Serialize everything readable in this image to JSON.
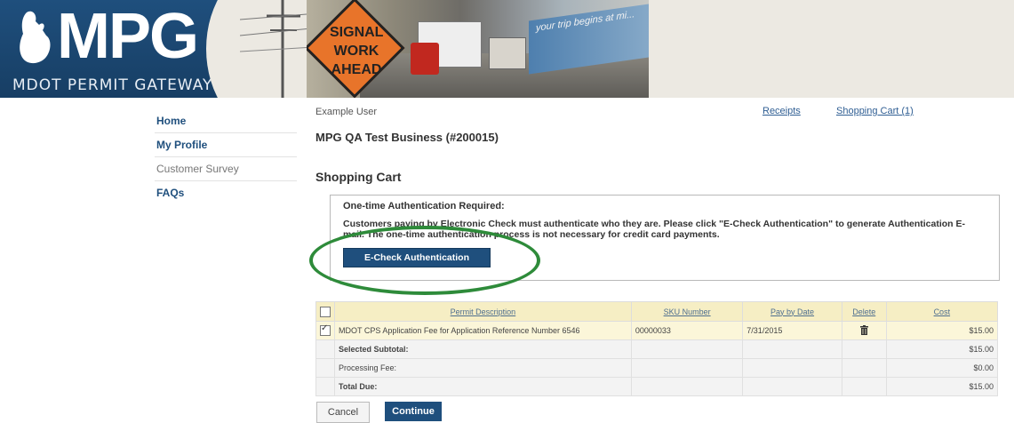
{
  "banner": {
    "logo_text": "MPG",
    "logo_subtitle": "MDOT PERMIT GATEWAY",
    "sign_text": "SIGNAL WORK AHEAD",
    "billboard_text": "your trip begins at mi..."
  },
  "nav": {
    "items": [
      {
        "label": "Home"
      },
      {
        "label": "My Profile"
      },
      {
        "label": "Customer Survey"
      },
      {
        "label": "FAQs"
      }
    ]
  },
  "header": {
    "user": "Example User",
    "receipts_link": "Receipts",
    "cart_link": "Shopping Cart (1)",
    "business": "MPG QA Test Business (#200015)",
    "page_title": "Shopping Cart"
  },
  "auth": {
    "title": "One-time Authentication Required:",
    "message": "Customers paying by Electronic Check must authenticate who they are. Please click \"E-Check Authentication\" to generate Authentication E-mail. The one-time authentication process is not necessary for credit card payments.",
    "button_label": "E-Check Authentication"
  },
  "cart": {
    "columns": {
      "description": "Permit Description",
      "sku": "SKU Number",
      "pay_by": "Pay by Date",
      "delete": "Delete",
      "cost": "Cost"
    },
    "items": [
      {
        "checked": true,
        "description": "MDOT CPS Application Fee for Application Reference Number 6546",
        "sku": "00000033",
        "pay_by": "7/31/2015",
        "cost": "$15.00"
      }
    ],
    "summary": [
      {
        "label": "Selected Subtotal:",
        "value": "$15.00"
      },
      {
        "label": "Processing Fee:",
        "value": "$0.00"
      },
      {
        "label": "Total Due:",
        "value": "$15.00"
      }
    ]
  },
  "actions": {
    "cancel_label": "Cancel",
    "continue_label": "Continue"
  }
}
